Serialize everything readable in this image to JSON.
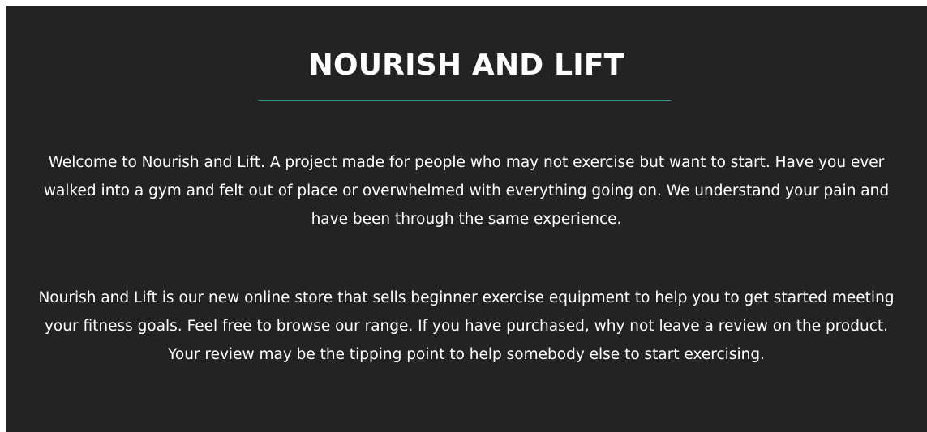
{
  "header": {
    "title": "NOURISH AND LIFT"
  },
  "main": {
    "paragraphs": [
      "Welcome to Nourish and Lift. A project made for people who may not exercise but want to start. Have you ever walked into a gym and felt out of place or overwhelmed with everything going on. We understand your pain and have been through the same experience.",
      "Nourish and Lift is our new online store that sells beginner exercise equipment to help you to get started meeting your fitness goals. Feel free to browse our range. If you have purchased, why not leave a review on the product. Your review may be the tipping point to help somebody else to start exercising."
    ]
  },
  "colors": {
    "background": "#232323",
    "text": "#ffffff",
    "divider": "#2f8f97"
  }
}
